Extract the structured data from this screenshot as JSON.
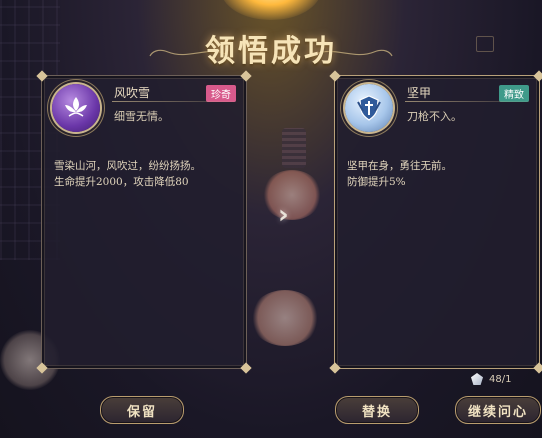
{
  "title": "领悟成功",
  "left_skill": {
    "name": "风吹雪",
    "rarity": "珍奇",
    "tagline": "细雪无情。",
    "description_lines": [
      "雪染山河，风吹过，纷纷扬扬。",
      "生命提升2000，攻击降低80"
    ],
    "icon": "lotus-icon",
    "rarity_color": "#d85a8c"
  },
  "right_skill": {
    "name": "坚甲",
    "rarity": "精致",
    "tagline": "刀枪不入。",
    "description_lines": [
      "坚甲在身，勇往无前。",
      "防御提升5%"
    ],
    "icon": "shield-swords-icon",
    "rarity_color": "#3f9a8a"
  },
  "counter": "48/1",
  "buttons": {
    "keep": "保留",
    "swap": "替换",
    "continue": "继续问心"
  }
}
